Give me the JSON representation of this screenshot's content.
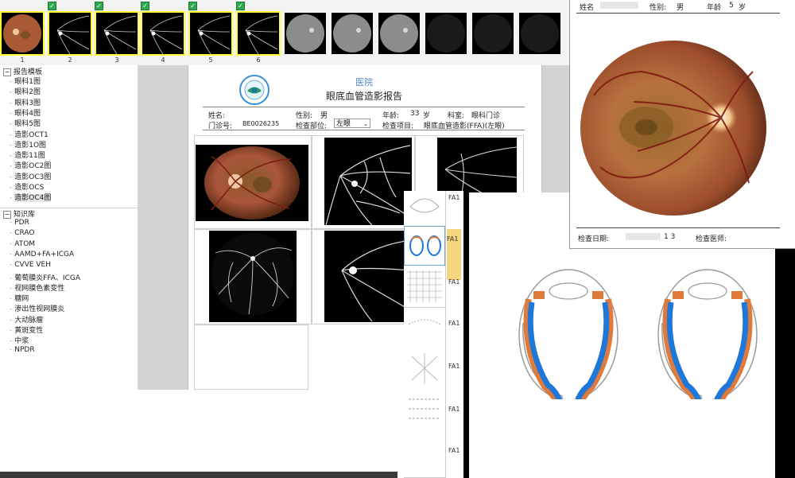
{
  "thumbnails": [
    {
      "num": "1",
      "kind": "color",
      "selected": true,
      "checked": false
    },
    {
      "num": "2",
      "kind": "fa",
      "selected": true,
      "checked": true
    },
    {
      "num": "3",
      "kind": "fa",
      "selected": true,
      "checked": true
    },
    {
      "num": "4",
      "kind": "fa",
      "selected": true,
      "checked": true
    },
    {
      "num": "5",
      "kind": "fa",
      "selected": true,
      "checked": true
    },
    {
      "num": "6",
      "kind": "fa",
      "selected": true,
      "checked": true
    },
    {
      "num": "",
      "kind": "gray",
      "selected": false,
      "checked": false
    },
    {
      "num": "",
      "kind": "gray",
      "selected": false,
      "checked": false
    },
    {
      "num": "",
      "kind": "gray",
      "selected": false,
      "checked": false
    },
    {
      "num": "",
      "kind": "dark",
      "selected": false,
      "checked": false
    },
    {
      "num": "",
      "kind": "dark",
      "selected": false,
      "checked": false
    },
    {
      "num": "",
      "kind": "dark",
      "selected": false,
      "checked": false
    }
  ],
  "tree": {
    "group1": "报告模板",
    "group1_items": [
      "眼科1图",
      "眼科2图",
      "眼科3图",
      "眼科4图",
      "眼科5图",
      "造影OCT1",
      "造影1O图",
      "造影11图",
      "造影OC2图",
      "造影OC3图",
      "造影OCS",
      "造影OC4图"
    ],
    "group2": "知识库",
    "group2_items": [
      "PDR",
      "CRAO",
      "ATOM",
      "AAMD+FA+ICGA",
      "CVVE VEH",
      "葡萄膜炎FFA、ICGA",
      "视网膜色素变性",
      "糖网",
      "渗出性视网膜炎",
      "大动脉瘤",
      "黄斑变性",
      "中浆",
      "NPDR"
    ]
  },
  "report": {
    "hospital": "医院",
    "title": "眼底血管造影报告",
    "name_label": "姓名:",
    "gender_label": "性别:",
    "gender_value": "男",
    "age_label": "年龄:",
    "age_value": "33",
    "age_unit": "岁",
    "dept_label": "科室:",
    "dept_value": "眼科门诊",
    "clinic_label": "门诊号:",
    "clinic_value": "BE0026235",
    "site_label": "检查部位:",
    "site_value": "左眼",
    "exam_label": "检查项目:",
    "exam_value": "眼底血管造影(FFA)(左眼)"
  },
  "fundus_report": {
    "name_label": "姓名",
    "gender_label": "性别:",
    "gender_value": "男",
    "age_label": "年龄",
    "age_value": "5",
    "age_unit": "岁",
    "date_label": "检查日期:",
    "date_value": "1 3",
    "doctor_label": "检查医师:"
  },
  "diagram": {
    "tab_labels": [
      "FA1",
      "FA1",
      "FA1",
      "FA1",
      "FA1",
      "FA1",
      "FA1"
    ],
    "colors": {
      "sclera": "#e07a3a",
      "choroid": "#1f78d8",
      "outline": "#9a9a9a"
    }
  }
}
